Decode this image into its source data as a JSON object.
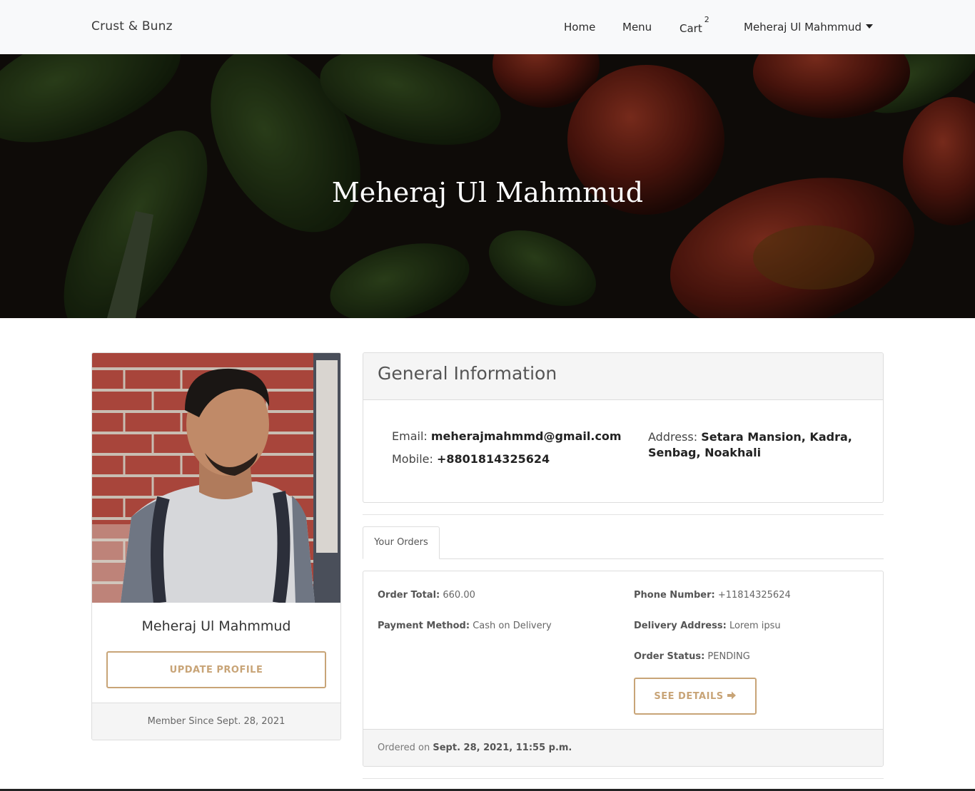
{
  "nav": {
    "brand": "Crust & Bunz",
    "home": "Home",
    "menu": "Menu",
    "cart": "Cart",
    "cart_count": "2",
    "user": "Meheraj Ul Mahmmud"
  },
  "hero": {
    "title": "Meheraj Ul Mahmmud"
  },
  "profile": {
    "name": "Meheraj Ul Mahmmud",
    "update_label": "UPDATE PROFILE",
    "member_since": "Member Since Sept. 28, 2021"
  },
  "general": {
    "title": "General Information",
    "email_label": "Email:",
    "email": "meherajmahmmd@gmail.com",
    "mobile_label": "Mobile:",
    "mobile": "+8801814325624",
    "address_label": "Address:",
    "address": "Setara Mansion, Kadra, Senbag, Noakhali"
  },
  "tabs": {
    "orders": "Your Orders"
  },
  "order": {
    "total_label": "Order Total:",
    "total": "660.00",
    "payment_label": "Payment Method:",
    "payment": "Cash on Delivery",
    "phone_label": "Phone Number:",
    "phone": "+11814325624",
    "address_label": "Delivery Address:",
    "address": "Lorem ipsu",
    "status_label": "Order Status:",
    "status": "PENDING",
    "details_label": "SEE DETAILS",
    "ordered_on_label": "Ordered on",
    "ordered_on": "Sept. 28, 2021, 11:55 p.m."
  },
  "colors": {
    "accent": "#c8a477",
    "navbar": "#f8f9fa",
    "card_header": "#f5f5f5"
  },
  "icons": {
    "caret": "caret-down-icon",
    "arrow": "arrow-right-icon"
  }
}
